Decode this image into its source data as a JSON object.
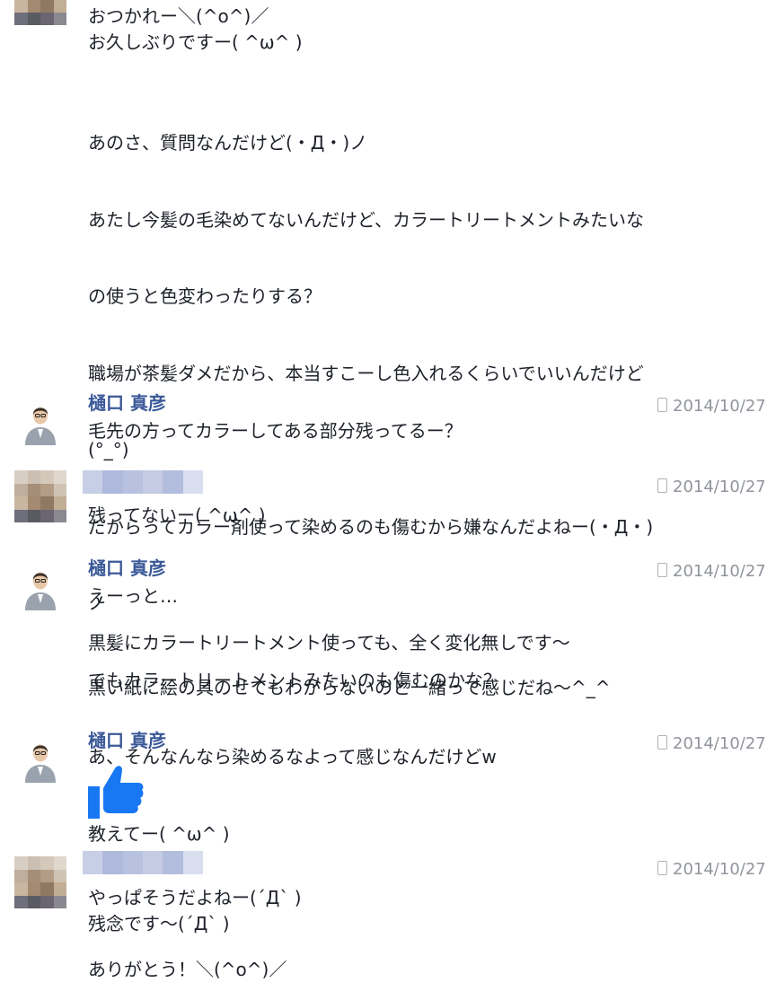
{
  "messages": [
    {
      "sender": "",
      "time": "",
      "lines": [
        "おつかれー＼(^o^)／",
        "お久しぶりですー( ^ω^ )"
      ]
    },
    {
      "sender": "",
      "time": "",
      "lines": [
        "あのさ、質問なんだけど(・Д・)ノ",
        "あたし今髪の毛染めてないんだけど、カラートリートメントみたいな",
        "の使うと色変わったりする？",
        "職場が茶髪ダメだから、本当すこーし色入れるくらいでいいんだけど",
        "(°_°)",
        "だからってカラー剤使って染めるのも傷むから嫌なんだよねー(・Д・)",
        "ノ",
        "でもカラートリートメントみたいのも傷むのかな？",
        "あ、そんなんなら染めるなよって感じなんだけどw",
        "教えてー( ^ω^ )"
      ]
    },
    {
      "sender": "樋口 真彦",
      "time": "2014/10/27",
      "lines": [
        "毛先の方ってカラーしてある部分残ってるー？"
      ]
    },
    {
      "sender": "",
      "time": "2014/10/27",
      "lines": [
        "残ってないー( ^ω^ )"
      ]
    },
    {
      "sender": "樋口 真彦",
      "time": "2014/10/27",
      "lines": [
        "えーっと…"
      ]
    },
    {
      "sender": "",
      "time": "",
      "lines": [
        "黒髪にカラートリートメント使っても、全く変化無しです〜"
      ]
    },
    {
      "sender": "",
      "time": "",
      "lines": [
        "黒い紙に絵の具のせてもわからないのと一緒って感じだね〜^_^"
      ]
    },
    {
      "sender": "樋口 真彦",
      "time": "2014/10/27",
      "sticker": "thumbs-up-icon"
    },
    {
      "sender": "",
      "time": "2014/10/27",
      "lines": [
        "やっぱそうだよねー(´Д` )",
        "残念です〜(´Д` )"
      ]
    },
    {
      "sender": "",
      "time": "",
      "lines": [
        "ありがとう！＼(^o^)／"
      ]
    }
  ],
  "colors": {
    "sender_name": "#3b5998",
    "timestamp": "#90949c",
    "like_blue": "#1877f2"
  }
}
